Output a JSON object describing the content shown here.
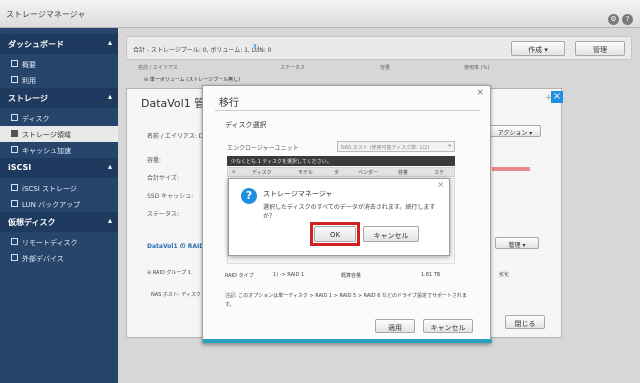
{
  "window": {
    "title": "ストレージマネージャ"
  },
  "sidebar": {
    "sections": [
      {
        "label": "ダッシュボード",
        "items": [
          {
            "label": "概要"
          },
          {
            "label": "利用"
          }
        ]
      },
      {
        "label": "ストレージ",
        "items": [
          {
            "label": "ディスク"
          },
          {
            "label": "ストレージ領域"
          },
          {
            "label": "キャッシュ加速"
          }
        ]
      },
      {
        "label": "iSCSI",
        "items": [
          {
            "label": "iSCSI ストレージ"
          },
          {
            "label": "LUN バックアップ"
          }
        ]
      },
      {
        "label": "仮想ディスク",
        "items": [
          {
            "label": "リモートディスク"
          },
          {
            "label": "外部デバイス"
          }
        ]
      }
    ]
  },
  "main": {
    "breadcrumb": "合計 - ストレージプール: 0, ボリューム: 1, LUN: 0",
    "create_label": "作成",
    "manage_label": "管理",
    "table_head": {
      "name": "名前 / エイリアス",
      "status": "ステータス",
      "capacity": "容量",
      "used": "使用率 (%)"
    },
    "row_label": "単一ボリューム (ストレージプール無し)"
  },
  "datavol": {
    "title": "DataVol1 管理",
    "name_alias": "名前 / エイリアス: Data",
    "capacity": "容量:",
    "total_size": "合計サイズ:",
    "ssd_cache": "SSD キャッシュ:",
    "status": "ステータス:",
    "raid_link": "DataVol1 の RAID グ",
    "action_label": "アクション",
    "manage_label": "管理",
    "close_label": "閉じる",
    "raid_row": "RAID グループ 1",
    "nas_row": "NAS ホスト: ディスク 1",
    "degrade": "劣化"
  },
  "migrate": {
    "title": "移行",
    "section": "ディスク選択",
    "enclosure_label": "エンクロージャーユニット",
    "enclosure_value": "NAS ホスト (使用可能ディスク数: 1/2)",
    "hint": "少なくとも 1 ディスクを選択してください。",
    "columns": [
      "ディスク",
      "モデル",
      "タ",
      "ベンダー",
      "容量",
      "ステ"
    ],
    "raid_type_label": "RAID タイプ",
    "raid_type_value": "1) -> RAID 1",
    "capacity_label": "概算容量",
    "capacity_value": "1.81 TB",
    "note": "注記: このオプションは単一ディスク > RAID 1 > RAID 5 > RAID 6 などのドライブ設定でサポートされます。",
    "apply_label": "適用",
    "cancel_label": "キャンセル"
  },
  "confirm": {
    "title": "ストレージマネージャ",
    "message": "選択したディスクのすべてのデータが消去されます。続行しますか？",
    "ok_label": "OK",
    "cancel_label": "キャンセル"
  }
}
